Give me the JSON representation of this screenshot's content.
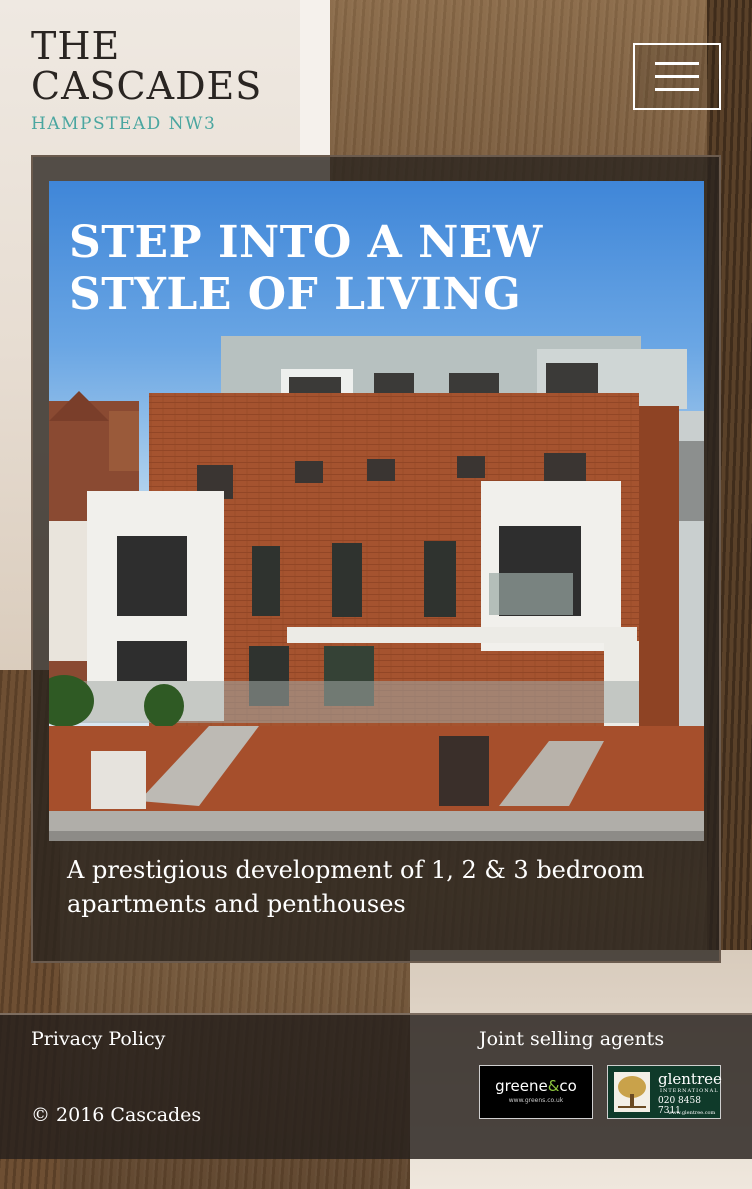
{
  "header": {
    "logo_line1": "THE",
    "logo_line2": "CASCADES",
    "logo_sub": "HAMPSTEAD NW3"
  },
  "hero": {
    "title": "STEP INTO A NEW STYLE OF LIVING",
    "description": "A prestigious development of 1, 2 & 3 bedroom apartments and penthouses"
  },
  "footer": {
    "privacy_label": "Privacy Policy",
    "copyright": "© 2016 Cascades",
    "agents_label": "Joint selling agents",
    "agents": [
      {
        "name_left": "greene",
        "name_amp": "&",
        "name_right": "co",
        "url": "www.greens.co.uk"
      },
      {
        "name": "glentree",
        "sub": "INTERNATIONAL",
        "phone": "020 8458 7311",
        "url": "www.glentree.com"
      }
    ]
  },
  "colors": {
    "accent_teal": "#4aa6a0",
    "logo_text": "#2a2522",
    "glentree_green": "#0f3a2a",
    "greene_green": "#8dc63f"
  },
  "icons": {
    "menu": "hamburger-menu-icon",
    "tree": "tree-icon"
  }
}
